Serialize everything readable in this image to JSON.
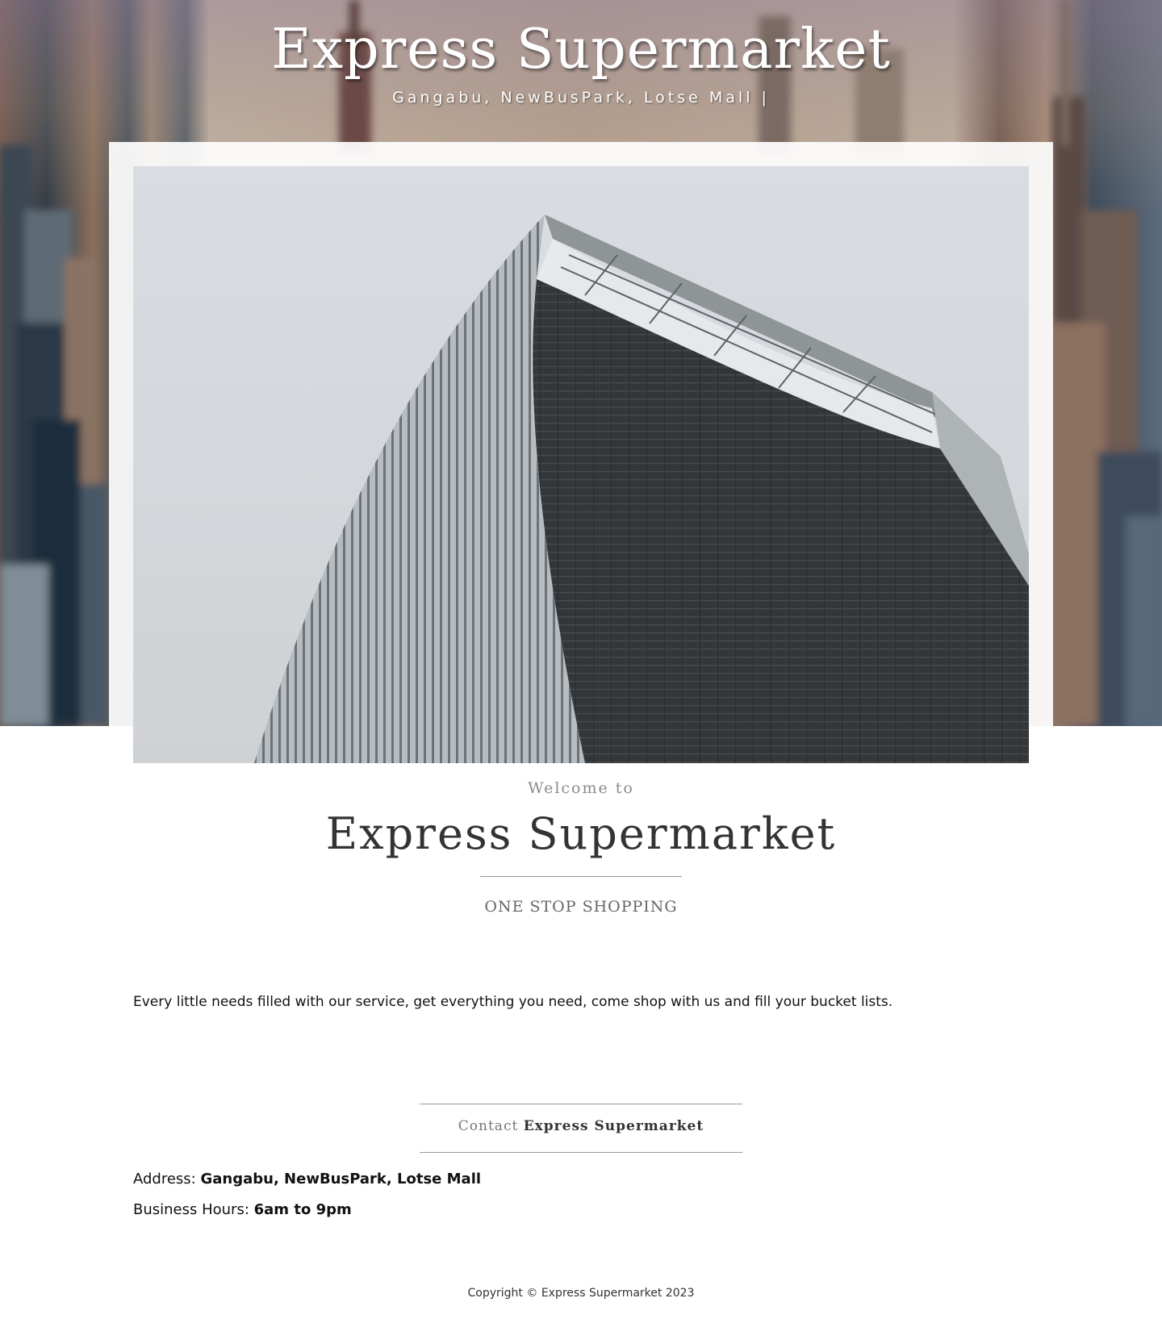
{
  "header": {
    "title": "Express Supermarket",
    "address": "Gangabu, NewBusPark, Lotse Mall |"
  },
  "intro": {
    "welcome": "Welcome to",
    "title": "Express Supermarket",
    "tagline": "ONE STOP SHOPPING"
  },
  "description": "Every little needs filled with our service, get everything you need, come shop with us and fill your bucket lists.",
  "contact": {
    "heading_prefix": "Contact",
    "heading_name": "Express Supermarket",
    "address_label": "Address:",
    "address_value": "Gangabu, NewBusPark, Lotse Mall",
    "hours_label": "Business Hours:",
    "hours_value": "6am to 9pm"
  },
  "footer": {
    "copyright": "Copyright © Express Supermarket 2023"
  },
  "colors": {
    "title_white": "#ffffff",
    "heading_dark": "#333333",
    "muted": "#8a8a8a"
  }
}
